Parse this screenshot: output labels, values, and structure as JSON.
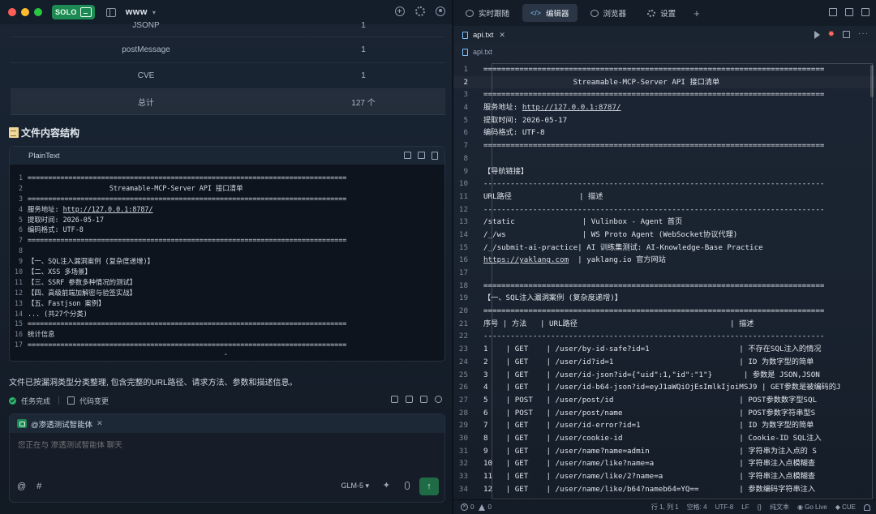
{
  "window": {
    "brand": "SOLO",
    "workspace": "www"
  },
  "stats_table": {
    "rows": [
      {
        "label": "JSONP",
        "value": "1"
      },
      {
        "label": "postMessage",
        "value": "1"
      },
      {
        "label": "CVE",
        "value": "1"
      },
      {
        "label": "总计",
        "value": "127 个"
      }
    ]
  },
  "section": {
    "title": "文件内容结构"
  },
  "code_card": {
    "language": "PlainText",
    "lines": [
      {
        "n": "1",
        "t": "=============================================================================="
      },
      {
        "n": "2",
        "t": "                    Streamable-MCP-Server API 接口清单"
      },
      {
        "n": "3",
        "t": "=============================================================================="
      },
      {
        "n": "4",
        "t": "服务地址: ",
        "link": "http://127.0.0.1:8787/"
      },
      {
        "n": "5",
        "t": "提取时间: 2026-05-17"
      },
      {
        "n": "6",
        "t": "编码格式: UTF-8"
      },
      {
        "n": "7",
        "t": "=============================================================================="
      },
      {
        "n": "8",
        "t": ""
      },
      {
        "n": "9",
        "t": "【一、SQL注入漏洞案例 (复杂度递增)】"
      },
      {
        "n": "10",
        "t": "【二、XSS 多场景】"
      },
      {
        "n": "11",
        "t": "【三、SSRF 参数多种情况的测试】"
      },
      {
        "n": "12",
        "t": "【四、高级前端加解密与验签实战】"
      },
      {
        "n": "13",
        "t": "【五、Fastjson 案例】"
      },
      {
        "n": "14",
        "t": "... (共27个分类)"
      },
      {
        "n": "15",
        "t": "=============================================================================="
      },
      {
        "n": "16",
        "t": "统计信息"
      },
      {
        "n": "17",
        "t": "=============================================================================="
      }
    ]
  },
  "summary": "文件已按漏洞类型分类整理, 包含完整的URL路径、请求方法、参数和描述信息。",
  "status": {
    "done": "任务完成",
    "changes": "代码变更"
  },
  "composer": {
    "agent": "@渗透测试智能体",
    "placeholder": "您正在与 渗透测试智能体 聊天",
    "at": "@",
    "hash": "#",
    "model": "GLM-5"
  },
  "right_tabs": [
    {
      "label": "实时跟随",
      "icon": "follow-icon"
    },
    {
      "label": "编辑器",
      "icon": "code-icon"
    },
    {
      "label": "浏览器",
      "icon": "compass-icon"
    },
    {
      "label": "设置",
      "icon": "gear-icon"
    }
  ],
  "editor": {
    "file": "api.txt",
    "breadcrumb": "api.txt",
    "current_line": "2",
    "lines": [
      {
        "n": "1",
        "t": "============================================================================"
      },
      {
        "n": "2",
        "t": "                    Streamable-MCP-Server API 接口清单"
      },
      {
        "n": "3",
        "t": "============================================================================"
      },
      {
        "n": "4",
        "t": "服务地址: ",
        "link": "http://127.0.0.1:8787/"
      },
      {
        "n": "5",
        "t": "提取时间: 2026-05-17"
      },
      {
        "n": "6",
        "t": "编码格式: UTF-8"
      },
      {
        "n": "7",
        "t": "============================================================================"
      },
      {
        "n": "8",
        "t": ""
      },
      {
        "n": "9",
        "t": "【导航链接】"
      },
      {
        "n": "10",
        "t": "----------------------------------------------------------------------------"
      },
      {
        "n": "11",
        "t": "URL路径               | 描述"
      },
      {
        "n": "12",
        "t": "----------------------------------------------------------------------------"
      },
      {
        "n": "13",
        "t": "/static               | Vulinbox - Agent 首页"
      },
      {
        "n": "14",
        "t": "/_/ws                 | WS Proto Agent (WebSocket协议代理)"
      },
      {
        "n": "15",
        "t": "/_/submit-ai-practice| AI 训练集测试: AI-Knowledge-Base Practice"
      },
      {
        "n": "16",
        "t": "",
        "link": "https://yaklang.com",
        "after": "  | yaklang.io 官方网站"
      },
      {
        "n": "17",
        "t": ""
      },
      {
        "n": "18",
        "t": "============================================================================"
      },
      {
        "n": "19",
        "t": "【一、SQL注入漏洞案例 (复杂度递增)】"
      },
      {
        "n": "20",
        "t": "============================================================================"
      },
      {
        "n": "21",
        "t": "序号 | 方法   | URL路径                                  | 描述"
      },
      {
        "n": "22",
        "t": "----------------------------------------------------------------------------"
      },
      {
        "n": "23",
        "t": "1    | GET    | /user/by-id-safe?id=1                    | 不存在SQL注入的情况"
      },
      {
        "n": "24",
        "t": "2    | GET    | /user/id?id=1                            | ID 为数字型的简单"
      },
      {
        "n": "25",
        "t": "3    | GET    | /user/id-json?id={\"uid\":1,\"id\":\"1\"}       | 参数是 JSON,JSON"
      },
      {
        "n": "26",
        "t": "4    | GET    | /user/id-b64-json?id=eyJ1aWQiOjEsImlkIjoiMSJ9 | GET参数是被编码的J"
      },
      {
        "n": "27",
        "t": "5    | POST   | /user/post/id                            | POST参数数字型SQL"
      },
      {
        "n": "28",
        "t": "6    | POST   | /user/post/name                          | POST参数字符串型S"
      },
      {
        "n": "29",
        "t": "7    | GET    | /user/id-error?id=1                      | ID 为数字型的简单"
      },
      {
        "n": "30",
        "t": "8    | GET    | /user/cookie-id                          | Cookie-ID SQL注入"
      },
      {
        "n": "31",
        "t": "9    | GET    | /user/name?name=admin                    | 字符串为注入点的 S"
      },
      {
        "n": "32",
        "t": "10   | GET    | /user/name/like?name=a                   | 字符串注入点模糊查"
      },
      {
        "n": "33",
        "t": "11   | GET    | /user/name/like/2?name=a                 | 字符串注入点模糊查"
      },
      {
        "n": "34",
        "t": "12   | GET    | /user/name/like/b64?nameb64=YQ==         | 参数编码字符串注入"
      }
    ]
  },
  "statusbar": {
    "errors": "0",
    "warnings": "0",
    "position": "行 1, 列 1",
    "spaces": "空格: 4",
    "encoding": "UTF-8",
    "eol": "LF",
    "brackets": "{}",
    "filetype": "纯文本",
    "golive": "Go Live",
    "cue": "CUE"
  },
  "colors": {
    "accent_green": "#1d8a53",
    "link": "#d4dbe4",
    "bg": "#17212e"
  }
}
